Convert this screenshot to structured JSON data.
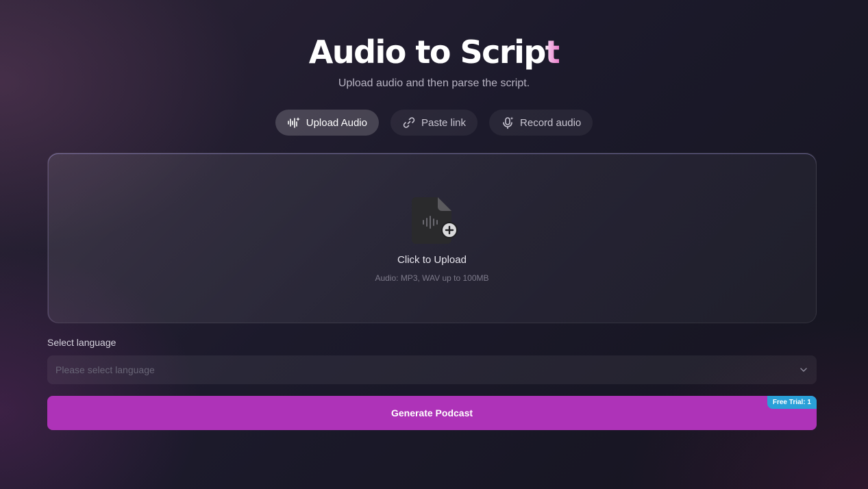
{
  "header": {
    "title_main": "Audio to Scrip",
    "title_accent": "t",
    "subtitle": "Upload audio and then parse the script."
  },
  "tabs": [
    {
      "label": "Upload Audio",
      "icon": "audio-sparkle-icon",
      "active": true
    },
    {
      "label": "Paste link",
      "icon": "link-icon",
      "active": false
    },
    {
      "label": "Record audio",
      "icon": "microphone-icon",
      "active": false
    }
  ],
  "upload": {
    "title": "Click to Upload",
    "hint": "Audio: MP3, WAV up to 100MB",
    "icon": "audio-file-add-icon"
  },
  "language": {
    "label": "Select language",
    "placeholder": "Please select language"
  },
  "generate": {
    "label": "Generate Podcast",
    "badge": "Free Trial: 1"
  },
  "colors": {
    "primary_button": "#ae33b8",
    "badge": "#2aa0d8",
    "title_accent": "#ea7fcb"
  }
}
